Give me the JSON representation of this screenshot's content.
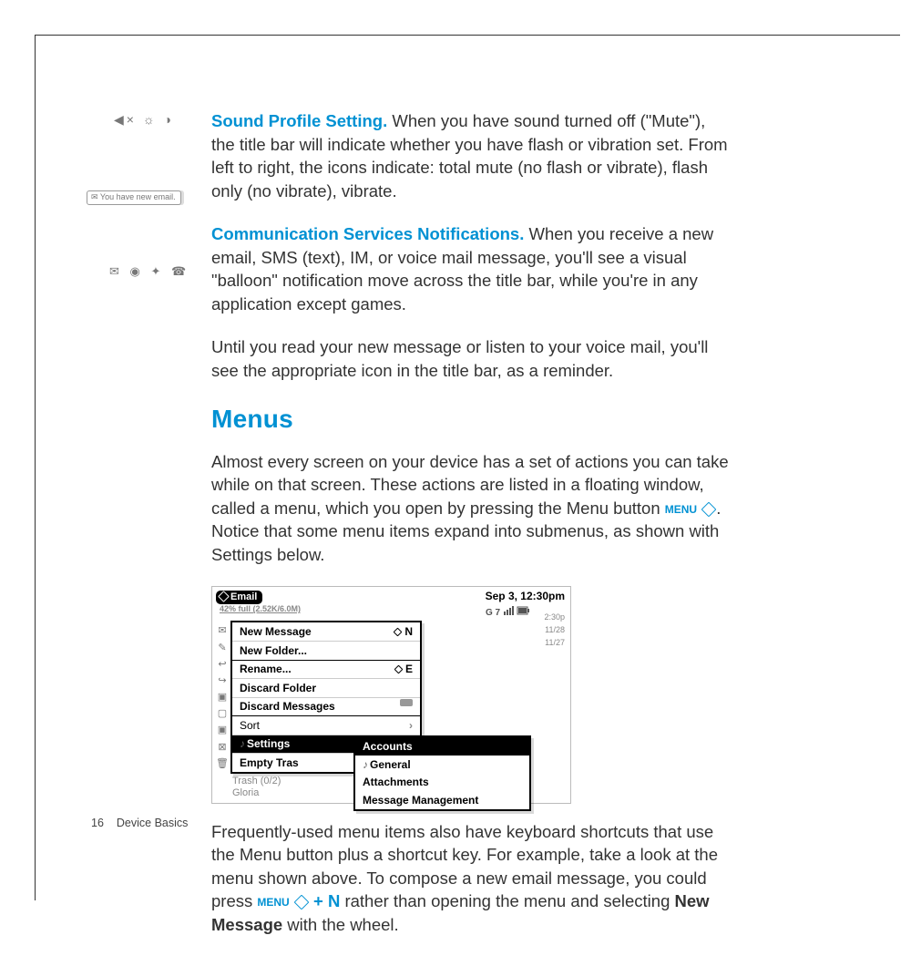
{
  "section1": {
    "title": "Sound Profile Setting.",
    "body": " When you have sound turned off (\"Mute\"), the title bar will indicate whether you have flash or vibration set. From left to right, the icons indicate: total mute (no flash or vibrate), flash only (no vibrate), vibrate."
  },
  "section2": {
    "title": "Communication Services Notifications.",
    "body": " When you receive a new email, SMS (text), IM, or voice mail message, you'll see a visual \"balloon\" notification move across the title bar, while you're in any application except games."
  },
  "section3": {
    "body": "Until you read your new message or listen to your voice mail, you'll see the appropriate icon in the title bar, as a reminder."
  },
  "menus": {
    "heading": "Menus",
    "p1a": "Almost every screen on your device has a set of actions you can take while on that screen. These actions are listed in a floating window, called a menu, which you open by pressing the Menu button ",
    "menulabel": "MENU",
    "p1b": ". Notice that some menu items expand into submenus, as shown with Settings below.",
    "p2a": "Frequently-used menu items also have keyboard shortcuts that use the Menu button plus a shortcut key. For example, take a look at the menu shown above. To compose a new email message, you could press ",
    "p2plus": "+",
    "p2key": " N",
    "p2b": " rather than opening the menu and selecting ",
    "p2bold": "New Message",
    "p2c": " with the wheel."
  },
  "device": {
    "app": "Email",
    "sub": "42% full (2.52K/6.0M)",
    "date": "Sep 3, 12:30pm",
    "menu_items": [
      {
        "label": "New Message",
        "shortcut": "N",
        "bold": true
      },
      {
        "label": "New Folder...",
        "bold": true
      },
      {
        "label": "Rename...",
        "shortcut": "E",
        "bold": true,
        "hr": true
      },
      {
        "label": "Discard Folder",
        "bold": true
      },
      {
        "label": "Discard Messages",
        "bold": true,
        "eraser": true
      },
      {
        "label": "Sort",
        "hr": true,
        "arrow": true
      },
      {
        "label": "Settings",
        "selected": true,
        "note": true
      },
      {
        "label": "Empty Tras",
        "bold": true
      }
    ],
    "submenu": [
      "Accounts",
      "General",
      "Attachments",
      "Message Management"
    ],
    "dates": [
      "2:30p",
      "11/28",
      "11/27"
    ],
    "below1": "Trash (0/2)",
    "below2": "Gloria"
  },
  "margin": {
    "balloon_text": "You have new email."
  },
  "footer": {
    "page": "16",
    "label": "Device Basics"
  }
}
